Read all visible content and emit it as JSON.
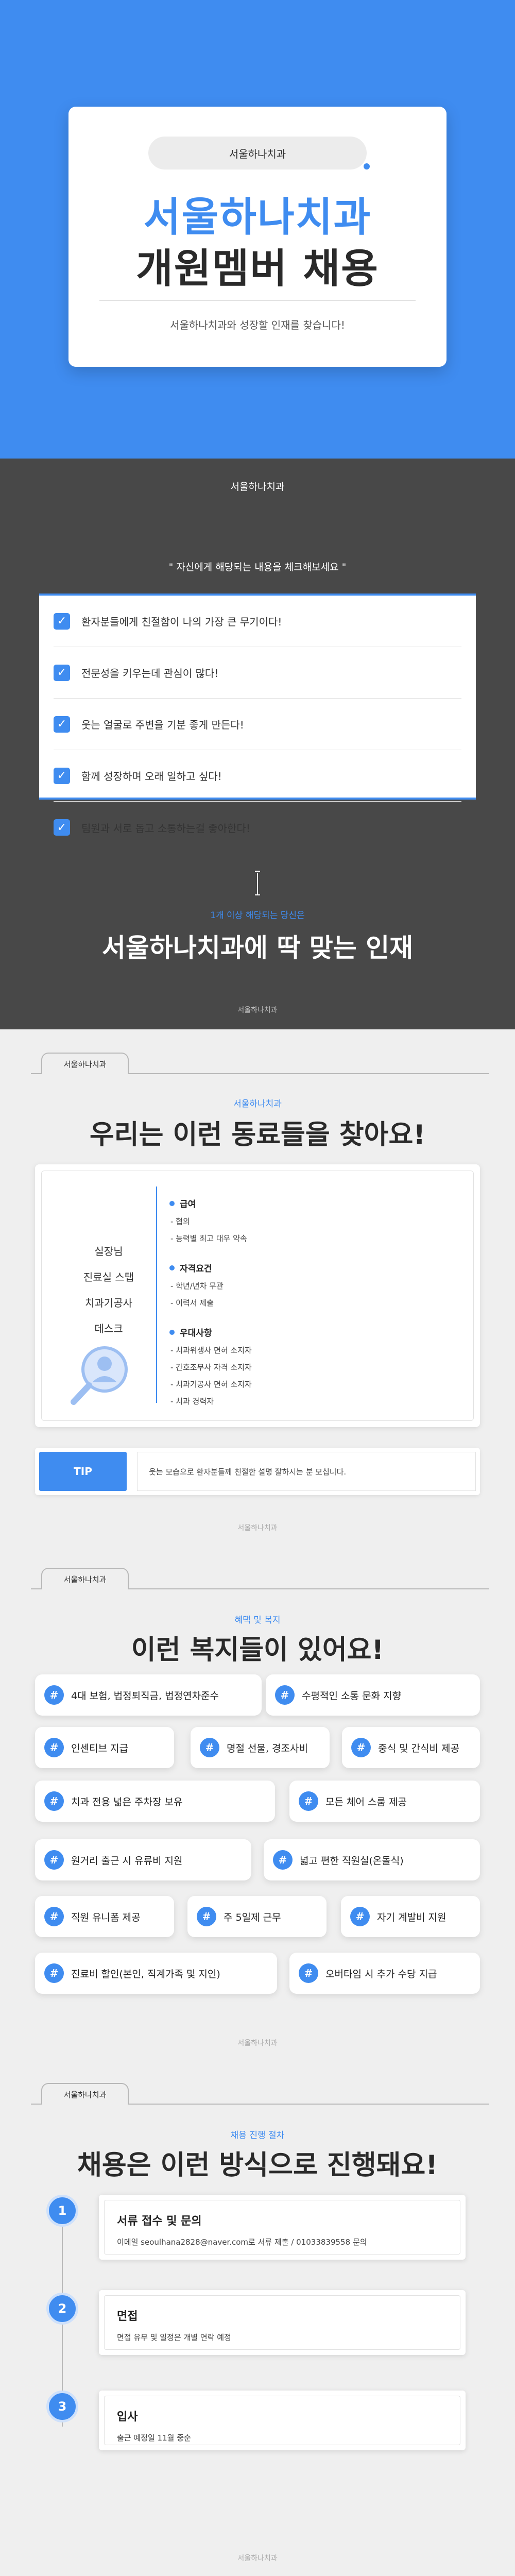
{
  "colors": {
    "accent": "#3f8cf0",
    "dark_bg": "#484848",
    "page_bg": "#efefef"
  },
  "hero": {
    "brand_pill": "서울하나치과",
    "title_line1": "서울하나치과",
    "title_line2": "개원멤버 채용",
    "subtitle": "서울하나치과와 성장할 인재를 찾습니다!"
  },
  "fit": {
    "brand": "서울하나치과",
    "quote": "\" 자신에게 해당되는 내용을 체크해보세요 \"",
    "checklist": [
      "환자분들에게 친절함이 나의 가장 큰 무기이다!",
      "전문성을 키우는데 관심이 많다!",
      "웃는 얼굴로 주변을 기분 좋게 만든다!",
      "함께 성장하며 오래 일하고 싶다!",
      "팀원과 서로 돕고 소통하는걸 좋아한다!"
    ],
    "check_icon": "checkmark-icon",
    "kicker": "1개 이상 해당되는 당신은",
    "title": "서울하나치과에 딱 맞는 인재",
    "footer": "서울하나치과"
  },
  "colleagues": {
    "tab": "서울하나치과",
    "kicker": "서울하나치과",
    "title": "우리는 이런 동료들을 찾아요!",
    "roles": [
      "실장님",
      "진료실 스탭",
      "치과기공사",
      "데스크"
    ],
    "requirements": [
      {
        "title": "급여",
        "items": [
          "- 협의",
          "- 능력별 최고 대우 약속"
        ]
      },
      {
        "title": "자격요건",
        "items": [
          "- 학년/년차 무관",
          "- 이력서 제출"
        ]
      },
      {
        "title": "우대사항",
        "items": [
          "- 치과위생사 면허 소지자",
          "- 간호조무사 자격 소지자",
          "- 치과기공사 면허 소지자",
          "- 치과 경력자"
        ]
      }
    ],
    "tip_label": "TIP",
    "tip_text": "웃는 모습으로 환자분들께 친절한 설명 잘하시는 분 모십니다.",
    "footer": "서울하나치과"
  },
  "welfare": {
    "tab": "서울하나치과",
    "kicker": "혜택 및 복지",
    "title": "이런 복지들이 있어요!",
    "hash_symbol": "#",
    "items": [
      "4대 보험, 법정퇴직금, 법정연차준수",
      "수평적인 소통 문화 지향",
      "인센티브 지급",
      "명절 선물, 경조사비",
      "중식 및 간식비 제공",
      "치과 전용 넓은 주차장 보유",
      "모든 체어 스룸 제공",
      "원거리 출근 시 유류비 지원",
      "넓고 편한 직원실(온돌식)",
      "직원 유니폼 제공",
      "주 5일제 근무",
      "자기 계발비 지원",
      "진료비 할인(본인, 직계가족 및 지인)",
      "오버타임 시 추가 수당 지급"
    ],
    "footer": "서울하나치과"
  },
  "process": {
    "tab": "서울하나치과",
    "kicker": "채용 진행 절차",
    "title": "채용은 이런 방식으로 진행돼요!",
    "steps": [
      {
        "num": "1",
        "title": "서류 접수 및 문의",
        "desc": "이메일 seoulhana2828@naver.com로 서류 제출 / 01033839558 문의"
      },
      {
        "num": "2",
        "title": "면접",
        "desc": "면접 유무 및 일정은 개별 연락 예정"
      },
      {
        "num": "3",
        "title": "입사",
        "desc": "출근 예정일 11월 중순"
      }
    ],
    "footer": "서울하나치과"
  }
}
